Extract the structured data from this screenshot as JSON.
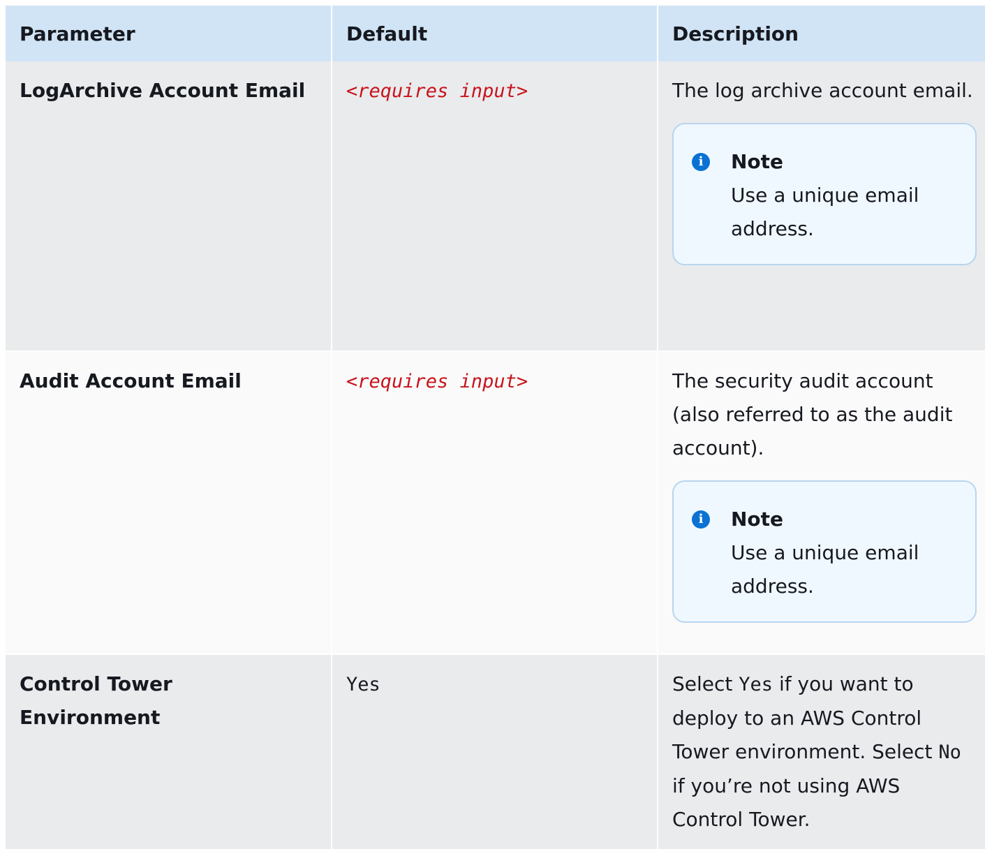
{
  "headers": {
    "parameter": "Parameter",
    "default": "Default",
    "description": "Description"
  },
  "rows": [
    {
      "parameter": "LogArchive Account Email",
      "default": "<requires input>",
      "description": "The log archive account email.",
      "note": {
        "title": "Note",
        "text": "Use a unique email address."
      }
    },
    {
      "parameter": "Audit Account Email",
      "default": "<requires input>",
      "description": "The security audit account (also referred to as the audit account).",
      "note": {
        "title": "Note",
        "text": "Use a unique email address."
      }
    },
    {
      "parameter": "Control Tower Environment",
      "default": "Yes",
      "description_parts": {
        "before_yes": "Select ",
        "yes_code": "Yes",
        "after_yes": " if you want to deploy to an AWS Control Tower environment. Select ",
        "no_code": "No",
        "after_no": " if you’re not using AWS Control Tower."
      }
    }
  ],
  "colors": {
    "header_bg": "#d1e4f5",
    "row_odd_bg": "#eaebed",
    "row_even_bg": "#fafafa",
    "required_text": "#c7141c",
    "note_bg": "#f0f8ff",
    "note_border": "#b7d5ef",
    "info_icon": "#0972d3"
  },
  "icons": {
    "note_icon": "info-icon"
  }
}
